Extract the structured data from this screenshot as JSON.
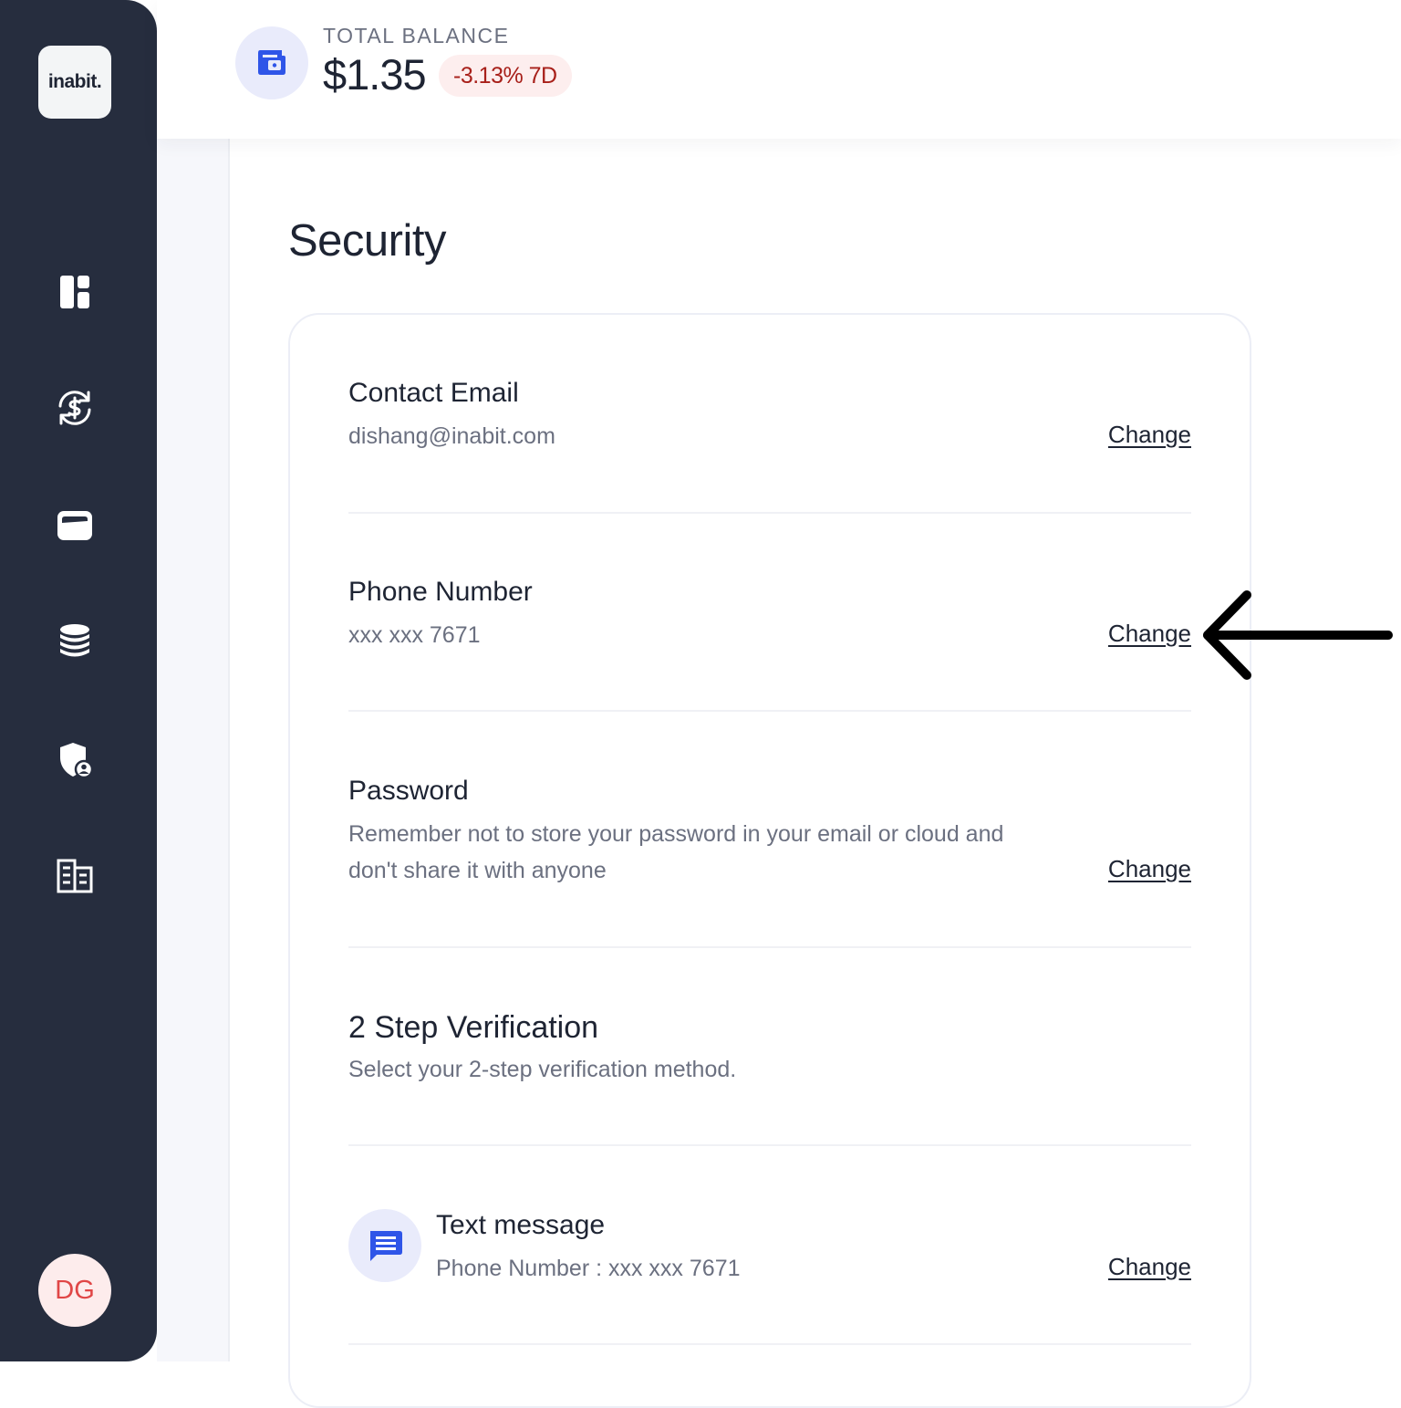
{
  "sidebar": {
    "logo_text": "inabit.",
    "nav_items": [
      {
        "icon": "dashboard-icon"
      },
      {
        "icon": "exchange-dollar-icon"
      },
      {
        "icon": "wallet-icon"
      },
      {
        "icon": "database-icon"
      },
      {
        "icon": "shield-user-icon"
      },
      {
        "icon": "building-icon"
      }
    ],
    "avatar_initials": "DG"
  },
  "header": {
    "balance_label": "TOTAL BALANCE",
    "balance_value": "$1.35",
    "balance_change": "-3.13% 7D"
  },
  "page": {
    "title": "Security"
  },
  "security": {
    "email": {
      "title": "Contact Email",
      "value": "dishang@inabit.com",
      "action": "Change"
    },
    "phone": {
      "title": "Phone Number",
      "value": "xxx xxx 7671",
      "action": "Change"
    },
    "password": {
      "title": "Password",
      "line1": "Remember not to store your password in your email or cloud and",
      "line2": "don't share it with anyone",
      "action": "Change"
    },
    "two_step": {
      "title": "2 Step Verification",
      "description": "Select your 2-step verification method."
    },
    "text_message": {
      "title": "Text message",
      "value": "Phone Number : xxx xxx 7671",
      "action": "Change"
    }
  },
  "colors": {
    "sidebar_bg": "#262d3e",
    "accent": "#2f55e8",
    "negative": "#a8201a",
    "avatar_text": "#e04646"
  }
}
